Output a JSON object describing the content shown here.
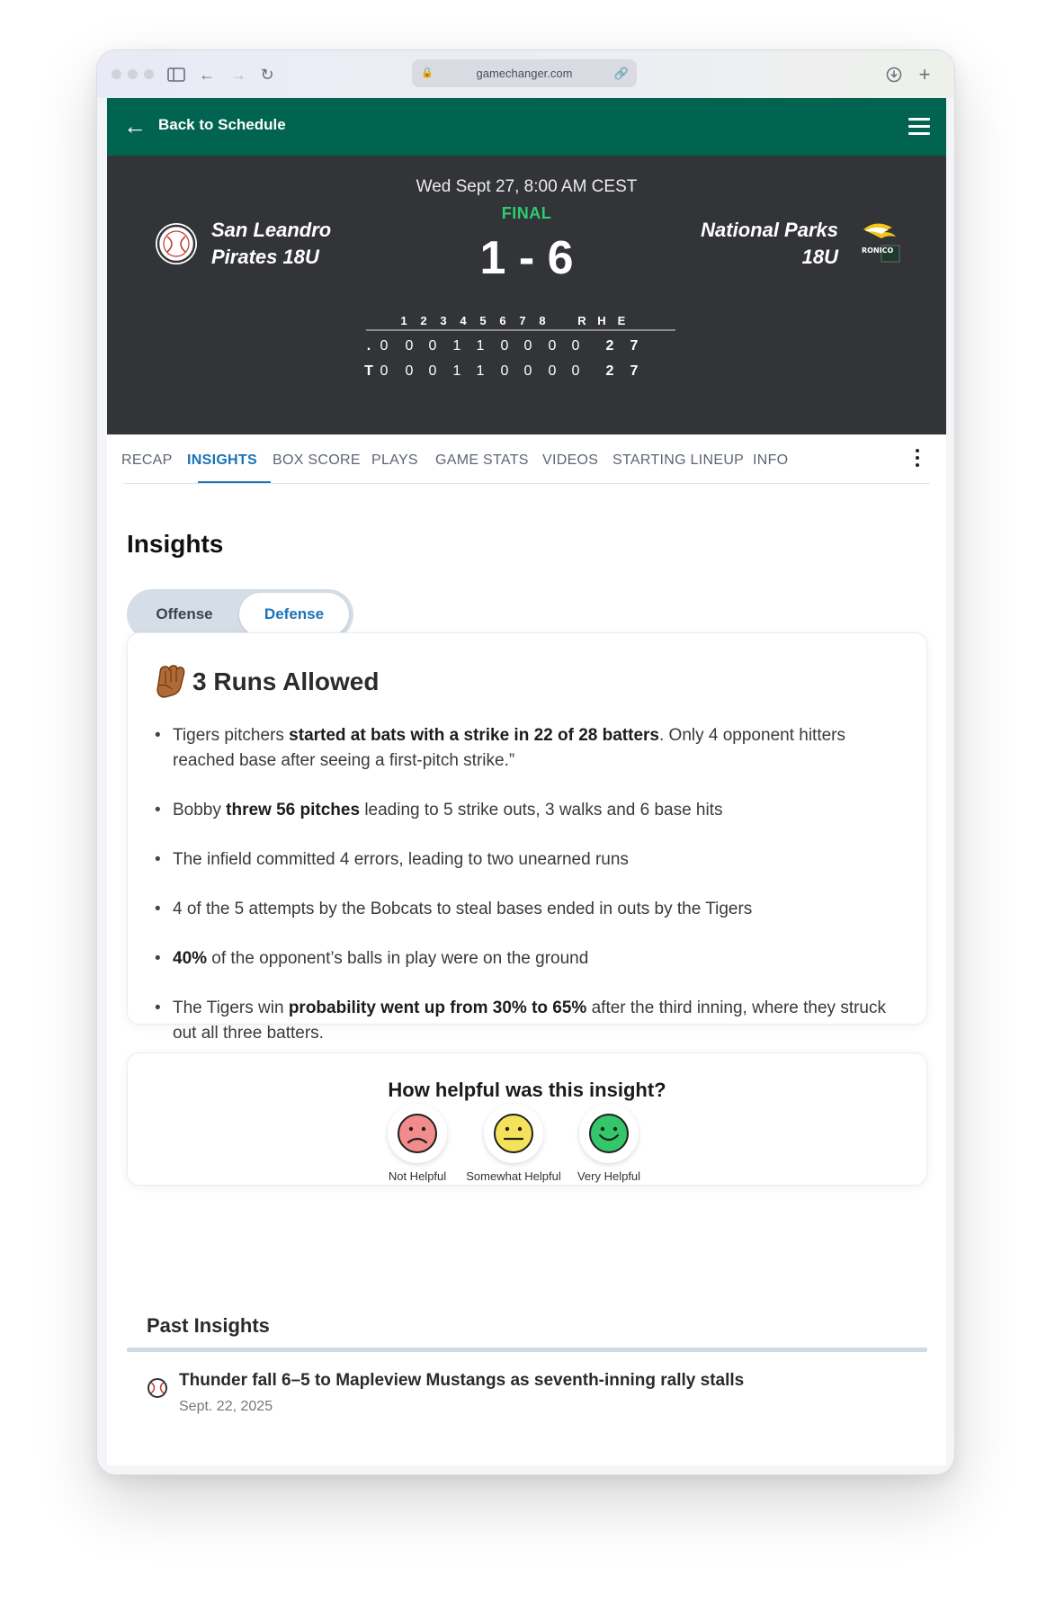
{
  "browser": {
    "url": "gamechanger.com"
  },
  "nav": {
    "back_label": "Back to Schedule"
  },
  "game": {
    "datetime": "Wed Sept 27, 8:00 AM CEST",
    "status": "FINAL",
    "score": "1 - 6",
    "home_team_line1": "San Leandro",
    "home_team_line2": "Pirates 18U",
    "away_team_line1": "National Parks",
    "away_team_line2": "18U",
    "away_logo_text": "RONICO"
  },
  "linescore": {
    "headers": [
      "1",
      "2",
      "3",
      "4",
      "5",
      "6",
      "7",
      "8",
      "R",
      "H",
      "E"
    ],
    "rows": [
      {
        "label": ".",
        "values": [
          "0",
          "0",
          "0",
          "1",
          "1",
          "0",
          "0",
          "0",
          "0",
          "2",
          "7"
        ]
      },
      {
        "label": "T",
        "values": [
          "0",
          "0",
          "0",
          "1",
          "1",
          "0",
          "0",
          "0",
          "0",
          "2",
          "7"
        ]
      }
    ]
  },
  "tabs": [
    "RECAP",
    "INSIGHTS",
    "BOX SCORE",
    "PLAYS",
    "GAME STATS",
    "VIDEOS",
    "STARTING LINEUP",
    "INFO"
  ],
  "active_tab": "INSIGHTS",
  "insights": {
    "heading": "Insights",
    "toggle_offense": "Offense",
    "toggle_defense": "Defense",
    "active_toggle": "Defense",
    "card_title": "3 Runs Allowed",
    "bullets": [
      [
        {
          "t": "Tigers pitchers ",
          "b": false
        },
        {
          "t": "started at bats with a strike in 22 of 28 batters",
          "b": true
        },
        {
          "t": ". Only 4 opponent hitters reached base after seeing a first-pitch strike.”",
          "b": false
        }
      ],
      [
        {
          "t": "Bobby ",
          "b": false
        },
        {
          "t": "threw 56 pitches",
          "b": true
        },
        {
          "t": " leading to 5 strike outs, 3 walks and 6 base hits",
          "b": false
        }
      ],
      [
        {
          "t": "The infield committed 4 errors, leading to two unearned runs",
          "b": false
        }
      ],
      [
        {
          "t": "4 of the 5 attempts by the Bobcats to steal bases ended in outs by the Tigers",
          "b": false
        }
      ],
      [
        {
          "t": "40%",
          "b": true
        },
        {
          "t": " of the opponent’s balls in play were on the ground",
          "b": false
        }
      ],
      [
        {
          "t": "The Tigers win ",
          "b": false
        },
        {
          "t": "probability went up from 30% to 65%",
          "b": true
        },
        {
          "t": " after the third inning, where they struck out all three batters.",
          "b": false
        }
      ]
    ]
  },
  "feedback": {
    "question": "How helpful was this insight?",
    "options": [
      {
        "label": "Not Helpful",
        "color": "#f28b8b",
        "icon": "frown-face-icon"
      },
      {
        "label": "Somewhat Helpful",
        "color": "#f4e35a",
        "icon": "neutral-face-icon"
      },
      {
        "label": "Very Helpful",
        "color": "#34c76a",
        "icon": "smile-face-icon"
      }
    ]
  },
  "past_insights": {
    "title": "Past Insights",
    "items": [
      {
        "title": "Thunder fall 6–5 to Mapleview Mustangs as seventh-inning rally stalls",
        "date": "Sept. 22, 2025"
      }
    ]
  },
  "colors": {
    "brand_green": "#006450",
    "scoreboard_bg": "#333438",
    "final_green": "#2ecc71",
    "active_tab_blue": "#1a73b8"
  }
}
